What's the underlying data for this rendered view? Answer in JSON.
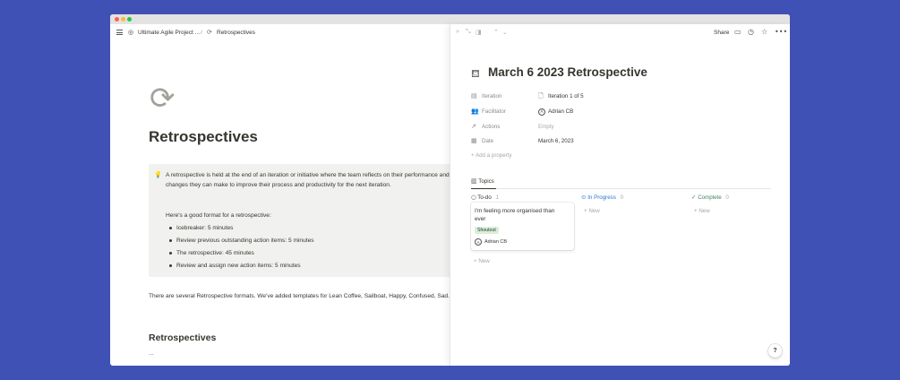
{
  "breadcrumb": {
    "workspace_icon": "◎",
    "workspace": "Ultimate Agile Project ...",
    "separator": "/",
    "page_icon": "⟳",
    "page": "Retrospectives"
  },
  "left": {
    "page_icon": "⟳",
    "title": "Retrospectives",
    "callout": {
      "icon": "💡",
      "paragraph": "A retrospective is held at the end of an iteration or initiative where the team reflects on their performance and identifies what changes they can make to improve their process and productivity for the next iteration.",
      "format_intro": "Here's a good format for a retrospective:",
      "bullets": [
        "Icebreaker: 5 minutes",
        "Review previous outstanding action items: 5 minutes",
        "The retrospective: 45 minutes",
        "Review and assign new action items: 5 minutes"
      ]
    },
    "paragraph": "There are several Retrospective formats. We've added templates for Lean Coffee, Sailboat, Happy, Confused, Sad.",
    "heading": "Retrospectives",
    "ellipsis": "..."
  },
  "panel": {
    "controls": [
      "»",
      "⤡",
      "◨",
      "⌃",
      "⌄"
    ],
    "share_label": "Share",
    "icons": {
      "comment": "comment-icon",
      "history": "clock-icon",
      "favorite": "star-icon",
      "more": "more-icon"
    },
    "title_icon": "⛾",
    "title": "March 6 2023 Retrospective",
    "properties": [
      {
        "icon": "▤",
        "label": "Iteration",
        "value": "Iteration 1 of 5",
        "value_icon": "🗋"
      },
      {
        "icon": "👥",
        "label": "Facilitator",
        "value": "Adrian CB",
        "avatar": "A"
      },
      {
        "icon": "↗",
        "label": "Actions",
        "value": "Empty"
      },
      {
        "icon": "▦",
        "label": "Date",
        "value": "March 6, 2023"
      }
    ],
    "add_property": "+ Add a property",
    "tab": {
      "icon": "▥",
      "label": "Topics"
    },
    "columns": [
      {
        "icon": "○",
        "label": "To-do",
        "count": "1",
        "color": "#37352f"
      },
      {
        "icon": "⊙",
        "label": "In Progress",
        "count": "0",
        "color": "#2e75cc"
      },
      {
        "icon": "✓",
        "label": "Complete",
        "count": "0",
        "color": "#448361"
      }
    ],
    "new_label": "+ New",
    "card": {
      "title": "I'm feeling more organised than ever",
      "tag": "Shoutout",
      "avatar": "A",
      "person": "Adrian CB"
    }
  },
  "help_label": "?"
}
